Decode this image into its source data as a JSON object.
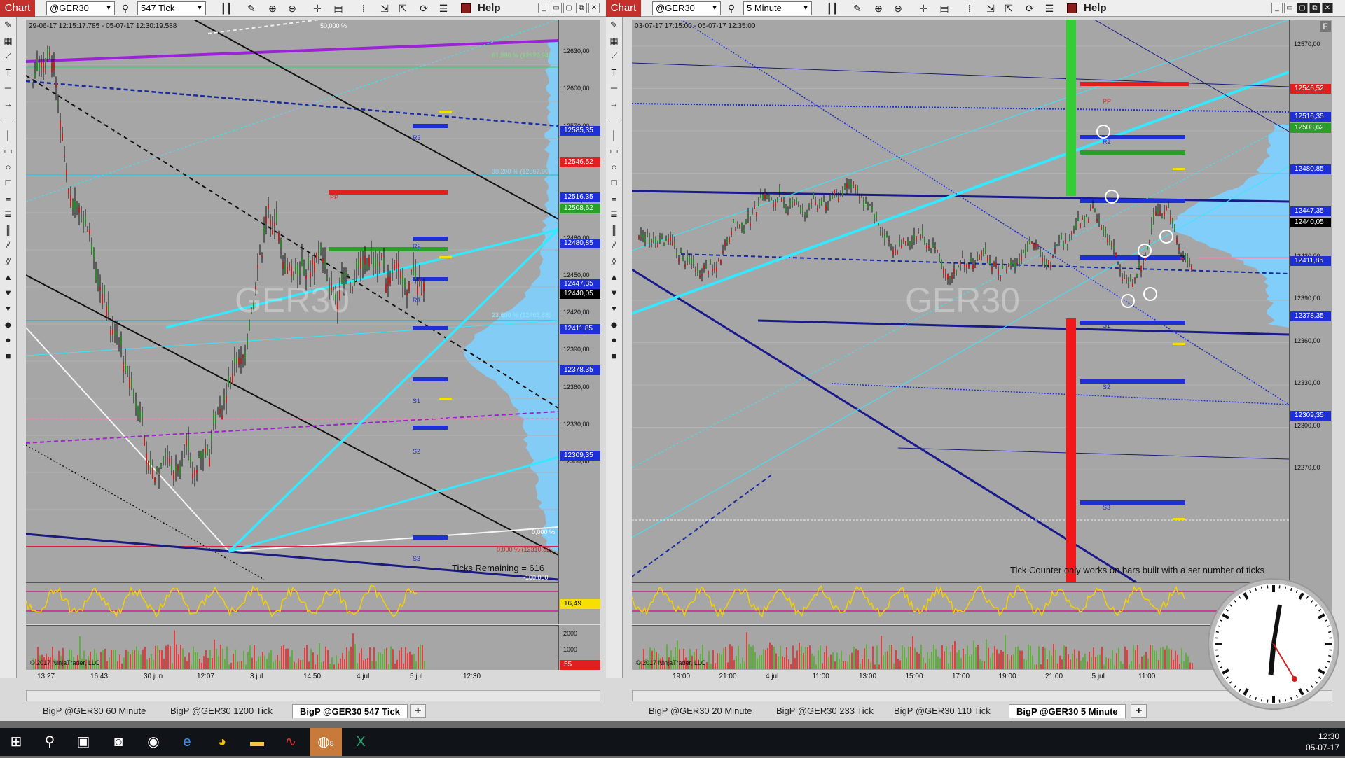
{
  "left": {
    "chart_label": "Chart",
    "instrument": "@GER30",
    "interval": "547 Tick",
    "help": "Help",
    "range": "29-06-17 12:15:17.785 - 05-07-17 12:30:19.588",
    "watermark": "GER30",
    "note": "Ticks Remaining = 616",
    "copyright": "© 2017 NinjaTrader, LLC",
    "fibs": [
      "50,000 %",
      "61,800 % (12620,94)",
      "38,200 % (12567,90)",
      "23,600 % (12462,88)",
      "0,000 %",
      "0,000 % (12310,32)",
      "-100,000"
    ],
    "pivots": [
      "R3",
      "R2",
      "R1",
      "PP",
      "S1",
      "S2",
      "S3"
    ],
    "price_ticks": [
      "12630,00",
      "12600,00",
      "12570,00",
      "12540,00",
      "12510,00",
      "12480,00",
      "12450,00",
      "12420,00",
      "12390,00",
      "12360,00",
      "12330,00",
      "12300,00"
    ],
    "price_labels": [
      {
        "text": "12585,35",
        "color": "#1f2fd6"
      },
      {
        "text": "12546,52",
        "color": "#e02020"
      },
      {
        "text": "12516,35",
        "color": "#1f2fd6"
      },
      {
        "text": "12508,62",
        "color": "#2aa02a"
      },
      {
        "text": "12480,85",
        "color": "#1f2fd6"
      },
      {
        "text": "12447,35",
        "color": "#1f2fd6"
      },
      {
        "text": "12440,05",
        "color": "#000000"
      },
      {
        "text": "12411,85",
        "color": "#1f2fd6"
      },
      {
        "text": "12378,35",
        "color": "#1f2fd6"
      },
      {
        "text": "12309,35",
        "color": "#1f2fd6"
      }
    ],
    "osc_value": "16,49",
    "vol_ticks": [
      "2000",
      "1000",
      "0"
    ],
    "vol_value": "55",
    "x_ticks": [
      "13:27",
      "16:43",
      "30 jun",
      "12:07",
      "3 jul",
      "14:50",
      "4 jul",
      "5 jul",
      "12:30"
    ],
    "tabs": [
      "BigP @GER30 60 Minute",
      "BigP @GER30 1200 Tick",
      "BigP @GER30 547 Tick",
      "+"
    ]
  },
  "right": {
    "chart_label": "Chart",
    "instrument": "@GER30",
    "interval": "5 Minute",
    "help": "Help",
    "range": "03-07-17 17:15:00 - 05-07-17 12:35:00",
    "watermark": "GER30",
    "note": "Tick Counter only works on bars built with a set number of ticks",
    "copyright": "© 2017 NinjaTrader, LLC",
    "pivots": [
      "R3",
      "R2",
      "R1",
      "PP",
      "S1",
      "S2",
      "S3"
    ],
    "corner": "F",
    "price_ticks": [
      "12570,00",
      "12540,00",
      "12510,00",
      "12480,00",
      "12450,00",
      "12420,00",
      "12390,00",
      "12360,00",
      "12330,00",
      "12300,00",
      "12270,00"
    ],
    "price_labels": [
      {
        "text": "12546,52",
        "color": "#e02020"
      },
      {
        "text": "12516,35",
        "color": "#1f2fd6"
      },
      {
        "text": "12508,62",
        "color": "#2aa02a"
      },
      {
        "text": "12480,85",
        "color": "#1f2fd6"
      },
      {
        "text": "12447,35",
        "color": "#1f2fd6"
      },
      {
        "text": "12440,05",
        "color": "#000000"
      },
      {
        "text": "12411,85",
        "color": "#1f2fd6"
      },
      {
        "text": "12378,35",
        "color": "#1f2fd6"
      },
      {
        "text": "12309,35",
        "color": "#1f2fd6"
      }
    ],
    "x_ticks": [
      "19:00",
      "21:00",
      "4 jul",
      "11:00",
      "13:00",
      "15:00",
      "17:00",
      "19:00",
      "21:00",
      "5 jul",
      "11:00"
    ],
    "tabs": [
      "BigP @GER30 20 Minute",
      "BigP @GER30 233 Tick",
      "BigP @GER30 110 Tick",
      "BigP @GER30 5 Minute",
      "+"
    ]
  },
  "taskbar": {
    "time": "12:30",
    "date": "05-07-17",
    "badge": "8"
  }
}
